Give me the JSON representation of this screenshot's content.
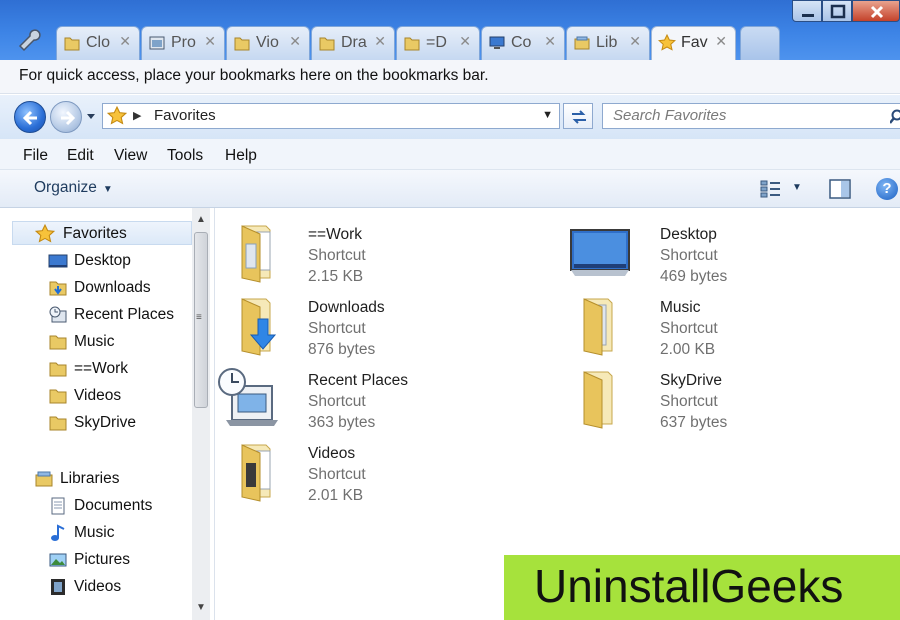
{
  "tabs": [
    {
      "label": "Clo",
      "icon": "folder-icon"
    },
    {
      "label": "Pro",
      "icon": "window-icon"
    },
    {
      "label": "Vio",
      "icon": "folder-icon"
    },
    {
      "label": "Dra",
      "icon": "folder-icon"
    },
    {
      "label": "=D",
      "icon": "folder-icon"
    },
    {
      "label": "Co",
      "icon": "computer-icon"
    },
    {
      "label": "Lib",
      "icon": "library-icon"
    },
    {
      "label": "Fav",
      "icon": "star-icon",
      "active": true
    }
  ],
  "bookmarks_bar": {
    "message": "For quick access, place your bookmarks here on the bookmarks bar."
  },
  "address": {
    "location": "Favorites"
  },
  "search": {
    "placeholder": "Search Favorites"
  },
  "menu": [
    "File",
    "Edit",
    "View",
    "Tools",
    "Help"
  ],
  "toolbar": {
    "organize_label": "Organize"
  },
  "nav": {
    "favorites": {
      "header": "Favorites",
      "items": [
        "Desktop",
        "Downloads",
        "Recent Places",
        "Music",
        "==Work",
        "Videos",
        "SkyDrive"
      ]
    },
    "libraries": {
      "header": "Libraries",
      "items": [
        "Documents",
        "Music",
        "Pictures",
        "Videos"
      ]
    }
  },
  "files": [
    {
      "name": "==Work",
      "type": "Shortcut",
      "size": "2.15 KB",
      "icon": "folder-docs-icon"
    },
    {
      "name": "Desktop",
      "type": "Shortcut",
      "size": "469 bytes",
      "icon": "desktop-icon"
    },
    {
      "name": "Downloads",
      "type": "Shortcut",
      "size": "876 bytes",
      "icon": "downloads-folder-icon"
    },
    {
      "name": "Music",
      "type": "Shortcut",
      "size": "2.00 KB",
      "icon": "folder-icon"
    },
    {
      "name": "Recent Places",
      "type": "Shortcut",
      "size": "363 bytes",
      "icon": "recent-places-icon"
    },
    {
      "name": "SkyDrive",
      "type": "Shortcut",
      "size": "637 bytes",
      "icon": "folder-icon"
    },
    {
      "name": "Videos",
      "type": "Shortcut",
      "size": "2.01 KB",
      "icon": "folder-docs-icon"
    }
  ],
  "watermark": {
    "text": "UninstallGeeks"
  },
  "colors": {
    "titlebar": "#3d84e6",
    "selection": "#dce9f8",
    "watermark": "#a6e23c"
  }
}
